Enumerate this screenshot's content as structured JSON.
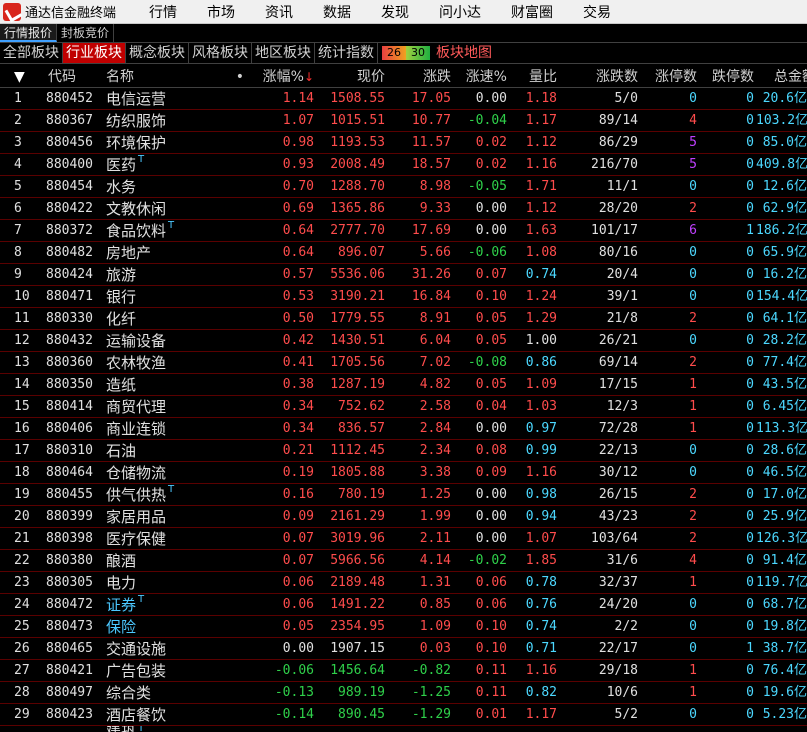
{
  "menubar": {
    "app_title": "通达信金融终端",
    "items": [
      "行情",
      "市场",
      "资讯",
      "数据",
      "发现",
      "问小达",
      "财富圈",
      "交易"
    ]
  },
  "subbar": {
    "tabs": [
      "行情报价",
      "封板竞价"
    ],
    "active": 0
  },
  "boardbar": {
    "tabs": [
      "全部板块",
      "行业板块",
      "概念板块",
      "风格板块",
      "地区板块",
      "统计指数"
    ],
    "active": 1,
    "legend_low": "26",
    "legend_high": "30",
    "map_link": "板块地图"
  },
  "columns": {
    "idx": "▼",
    "code": "代码",
    "name": "名称",
    "name_mark": "•",
    "pct": "涨幅%",
    "pct_sort": "↓",
    "price": "现价",
    "chg": "涨跌",
    "spd": "涨速%",
    "vr": "量比",
    "ud": "涨跌数",
    "zt": "涨停数",
    "dt": "跌停数",
    "amt": "总金额"
  },
  "colors": {
    "up": "#ff4c4c",
    "down": "#2fd04a",
    "cyan": "#4cd8ff",
    "active_tab": "#c00000"
  },
  "rows": [
    {
      "i": "1",
      "code": "880452",
      "name": "电信运营",
      "t": "",
      "pct": "1.14",
      "price": "1508.55",
      "chg": "17.05",
      "spd": "0.00",
      "vr": "1.18",
      "ud": "5/0",
      "zt": "0",
      "dt": "0",
      "amt": "20.6亿"
    },
    {
      "i": "2",
      "code": "880367",
      "name": "纺织服饰",
      "t": "",
      "pct": "1.07",
      "price": "1015.51",
      "chg": "10.77",
      "spd": "-0.04",
      "vr": "1.17",
      "ud": "89/14",
      "zt": "4",
      "dt": "0",
      "amt": "103.2亿"
    },
    {
      "i": "3",
      "code": "880456",
      "name": "环境保护",
      "t": "",
      "pct": "0.98",
      "price": "1193.53",
      "chg": "11.57",
      "spd": "0.02",
      "vr": "1.12",
      "ud": "86/29",
      "zt": "5",
      "dt": "0",
      "amt": "85.0亿"
    },
    {
      "i": "4",
      "code": "880400",
      "name": "医药",
      "t": "T",
      "pct": "0.93",
      "price": "2008.49",
      "chg": "18.57",
      "spd": "0.02",
      "vr": "1.16",
      "ud": "216/70",
      "zt": "5",
      "dt": "0",
      "amt": "409.8亿"
    },
    {
      "i": "5",
      "code": "880454",
      "name": "水务",
      "t": "",
      "pct": "0.70",
      "price": "1288.70",
      "chg": "8.98",
      "spd": "-0.05",
      "vr": "1.71",
      "ud": "11/1",
      "zt": "0",
      "dt": "0",
      "amt": "12.6亿"
    },
    {
      "i": "6",
      "code": "880422",
      "name": "文教休闲",
      "t": "",
      "pct": "0.69",
      "price": "1365.86",
      "chg": "9.33",
      "spd": "0.00",
      "vr": "1.12",
      "ud": "28/20",
      "zt": "2",
      "dt": "0",
      "amt": "62.9亿"
    },
    {
      "i": "7",
      "code": "880372",
      "name": "食品饮料",
      "t": "T",
      "pct": "0.64",
      "price": "2777.70",
      "chg": "17.69",
      "spd": "0.00",
      "vr": "1.63",
      "ud": "101/17",
      "zt": "6",
      "dt": "1",
      "amt": "186.2亿"
    },
    {
      "i": "8",
      "code": "880482",
      "name": "房地产",
      "t": "",
      "pct": "0.64",
      "price": "896.07",
      "chg": "5.66",
      "spd": "-0.06",
      "vr": "1.08",
      "ud": "80/16",
      "zt": "0",
      "dt": "0",
      "amt": "65.9亿"
    },
    {
      "i": "9",
      "code": "880424",
      "name": "旅游",
      "t": "",
      "pct": "0.57",
      "price": "5536.06",
      "chg": "31.26",
      "spd": "0.07",
      "vr": "0.74",
      "ud": "20/4",
      "zt": "0",
      "dt": "0",
      "amt": "16.2亿"
    },
    {
      "i": "10",
      "code": "880471",
      "name": "银行",
      "t": "",
      "pct": "0.53",
      "price": "3190.21",
      "chg": "16.84",
      "spd": "0.10",
      "vr": "1.24",
      "ud": "39/1",
      "zt": "0",
      "dt": "0",
      "amt": "154.4亿"
    },
    {
      "i": "11",
      "code": "880330",
      "name": "化纤",
      "t": "",
      "pct": "0.50",
      "price": "1779.55",
      "chg": "8.91",
      "spd": "0.05",
      "vr": "1.29",
      "ud": "21/8",
      "zt": "2",
      "dt": "0",
      "amt": "64.1亿"
    },
    {
      "i": "12",
      "code": "880432",
      "name": "运输设备",
      "t": "",
      "pct": "0.42",
      "price": "1430.51",
      "chg": "6.04",
      "spd": "0.05",
      "vr": "1.00",
      "ud": "26/21",
      "zt": "0",
      "dt": "0",
      "amt": "28.2亿"
    },
    {
      "i": "13",
      "code": "880360",
      "name": "农林牧渔",
      "t": "",
      "pct": "0.41",
      "price": "1705.56",
      "chg": "7.02",
      "spd": "-0.08",
      "vr": "0.86",
      "ud": "69/14",
      "zt": "2",
      "dt": "0",
      "amt": "77.4亿"
    },
    {
      "i": "14",
      "code": "880350",
      "name": "造纸",
      "t": "",
      "pct": "0.38",
      "price": "1287.19",
      "chg": "4.82",
      "spd": "0.05",
      "vr": "1.09",
      "ud": "17/15",
      "zt": "1",
      "dt": "0",
      "amt": "43.5亿"
    },
    {
      "i": "15",
      "code": "880414",
      "name": "商贸代理",
      "t": "",
      "pct": "0.34",
      "price": "752.62",
      "chg": "2.58",
      "spd": "0.04",
      "vr": "1.03",
      "ud": "12/3",
      "zt": "1",
      "dt": "0",
      "amt": "6.45亿"
    },
    {
      "i": "16",
      "code": "880406",
      "name": "商业连锁",
      "t": "",
      "pct": "0.34",
      "price": "836.57",
      "chg": "2.84",
      "spd": "0.00",
      "vr": "0.97",
      "ud": "72/28",
      "zt": "1",
      "dt": "0",
      "amt": "113.3亿"
    },
    {
      "i": "17",
      "code": "880310",
      "name": "石油",
      "t": "",
      "pct": "0.21",
      "price": "1112.45",
      "chg": "2.34",
      "spd": "0.08",
      "vr": "0.99",
      "ud": "22/13",
      "zt": "0",
      "dt": "0",
      "amt": "28.6亿"
    },
    {
      "i": "18",
      "code": "880464",
      "name": "仓储物流",
      "t": "",
      "pct": "0.19",
      "price": "1805.88",
      "chg": "3.38",
      "spd": "0.09",
      "vr": "1.16",
      "ud": "30/12",
      "zt": "0",
      "dt": "0",
      "amt": "46.5亿"
    },
    {
      "i": "19",
      "code": "880455",
      "name": "供气供热",
      "t": "T",
      "pct": "0.16",
      "price": "780.19",
      "chg": "1.25",
      "spd": "0.00",
      "vr": "0.98",
      "ud": "26/15",
      "zt": "2",
      "dt": "0",
      "amt": "17.0亿"
    },
    {
      "i": "20",
      "code": "880399",
      "name": "家居用品",
      "t": "",
      "pct": "0.09",
      "price": "2161.29",
      "chg": "1.99",
      "spd": "0.00",
      "vr": "0.94",
      "ud": "43/23",
      "zt": "2",
      "dt": "0",
      "amt": "25.9亿"
    },
    {
      "i": "21",
      "code": "880398",
      "name": "医疗保健",
      "t": "",
      "pct": "0.07",
      "price": "3019.96",
      "chg": "2.11",
      "spd": "0.00",
      "vr": "1.07",
      "ud": "103/64",
      "zt": "2",
      "dt": "0",
      "amt": "126.3亿"
    },
    {
      "i": "22",
      "code": "880380",
      "name": "酿酒",
      "t": "",
      "pct": "0.07",
      "price": "5966.56",
      "chg": "4.14",
      "spd": "-0.02",
      "vr": "1.85",
      "ud": "31/6",
      "zt": "4",
      "dt": "0",
      "amt": "91.4亿"
    },
    {
      "i": "23",
      "code": "880305",
      "name": "电力",
      "t": "",
      "pct": "0.06",
      "price": "2189.48",
      "chg": "1.31",
      "spd": "0.06",
      "vr": "0.78",
      "ud": "32/37",
      "zt": "1",
      "dt": "0",
      "amt": "119.7亿"
    },
    {
      "i": "24",
      "code": "880472",
      "name": "证券",
      "t": "T",
      "pct": "0.06",
      "price": "1491.22",
      "chg": "0.85",
      "spd": "0.06",
      "vr": "0.76",
      "ud": "24/20",
      "zt": "0",
      "dt": "0",
      "amt": "68.7亿",
      "cyan": true
    },
    {
      "i": "25",
      "code": "880473",
      "name": "保险",
      "t": "",
      "pct": "0.05",
      "price": "2354.95",
      "chg": "1.09",
      "spd": "0.10",
      "vr": "0.74",
      "ud": "2/2",
      "zt": "0",
      "dt": "0",
      "amt": "19.8亿",
      "cyan": true
    },
    {
      "i": "26",
      "code": "880465",
      "name": "交通设施",
      "t": "",
      "pct": "0.00",
      "price": "1907.15",
      "chg": "0.03",
      "spd": "0.10",
      "vr": "0.71",
      "ud": "22/17",
      "zt": "0",
      "dt": "1",
      "amt": "38.7亿"
    },
    {
      "i": "27",
      "code": "880421",
      "name": "广告包装",
      "t": "",
      "pct": "-0.06",
      "price": "1456.64",
      "chg": "-0.82",
      "spd": "0.11",
      "vr": "1.16",
      "ud": "29/18",
      "zt": "1",
      "dt": "0",
      "amt": "76.4亿"
    },
    {
      "i": "28",
      "code": "880497",
      "name": "综合类",
      "t": "",
      "pct": "-0.13",
      "price": "989.19",
      "chg": "-1.25",
      "spd": "0.11",
      "vr": "0.82",
      "ud": "10/6",
      "zt": "1",
      "dt": "0",
      "amt": "19.6亿"
    },
    {
      "i": "29",
      "code": "880423",
      "name": "酒店餐饮",
      "t": "",
      "pct": "-0.14",
      "price": "890.45",
      "chg": "-1.29",
      "spd": "0.01",
      "vr": "1.17",
      "ud": "5/2",
      "zt": "0",
      "dt": "0",
      "amt": "5.23亿"
    }
  ],
  "partial_row": {
    "name": "建筑",
    "t": "T"
  }
}
